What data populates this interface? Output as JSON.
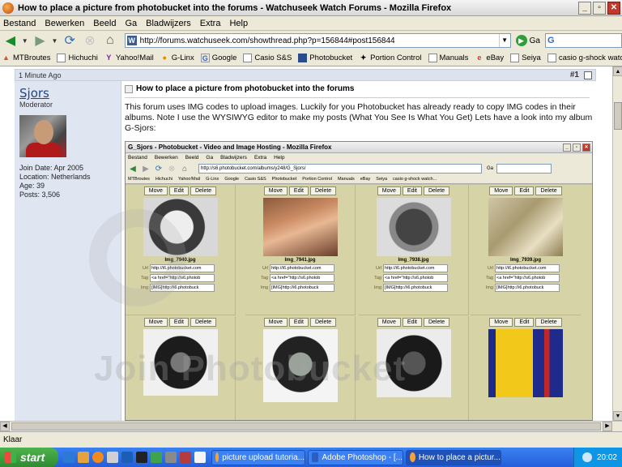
{
  "window": {
    "title": "How to place a picture from photobucket into the forums - Watchuseek Watch Forums - Mozilla Firefox"
  },
  "menu": [
    "Bestand",
    "Bewerken",
    "Beeld",
    "Ga",
    "Bladwijzers",
    "Extra",
    "Help"
  ],
  "nav": {
    "url": "http://forums.watchuseek.com/showthread.php?p=156844#post156844",
    "go_label": "Ga",
    "search_icon_text": "G"
  },
  "bookmarks": [
    "MTBroutes",
    "Hichuchi",
    "Yahoo!Mail",
    "G-Linx",
    "Google",
    "Casio S&S",
    "Photobucket",
    "Portion Control",
    "Manuals",
    "eBay",
    "Seiya",
    "casio g-shock watch..."
  ],
  "post": {
    "time": "1 Minute Ago",
    "number": "#1",
    "username": "Sjors",
    "usertitle": "Moderator",
    "join_date": "Join Date: Apr 2005",
    "location": "Location: Netherlands",
    "age": "Age: 39",
    "posts": "Posts: 3,506",
    "title": "How to place a picture from photobucket into the forums",
    "body": "This forum uses IMG codes to upload images. Luckily for you Photobucket has already ready to copy IMG codes in their albums. Note I use the WYSIWYG editor to make my posts (What You See Is What You Get) Lets have a look into my album G-Sjors:"
  },
  "embedded": {
    "title": "G_Sjors - Photobucket - Video and Image Hosting - Mozilla Firefox",
    "menu": [
      "Bestand",
      "Bewerken",
      "Beeld",
      "Ga",
      "Bladwijzers",
      "Extra",
      "Help"
    ],
    "url": "http://s6.photobucket.com/albums/y248/G_Sjors/",
    "go": "Ga",
    "bookmarks": [
      "MTBroutes",
      "Hichuchi",
      "Yahoo!Mail",
      "G-Linx",
      "Google",
      "Casio S&S",
      "Photobucket",
      "Portion Control",
      "Manuals",
      "eBay",
      "Seiya",
      "casio g-shock watch..."
    ],
    "buttons": {
      "move": "Move",
      "edit": "Edit",
      "delete": "Delete"
    },
    "field_labels": {
      "url": "Url",
      "tag": "Tag",
      "img": "Img"
    },
    "fields": {
      "url": "http://i6.photobucket.com",
      "tag": "<a href=\"http://s6.photob",
      "img": "[IMG]http://i6.photobuck"
    },
    "filenames": [
      "Img_7940.jpg",
      "Img_7941.jpg",
      "Img_7938.jpg",
      "Img_7939.jpg"
    ]
  },
  "watermark": "Join Photobucket",
  "status": "Klaar",
  "taskbar": {
    "start": "start",
    "tasks": [
      "picture upload tutoria...",
      "Adobe Photoshop - [...",
      "How to place a pictur..."
    ],
    "clock": "20:02"
  }
}
